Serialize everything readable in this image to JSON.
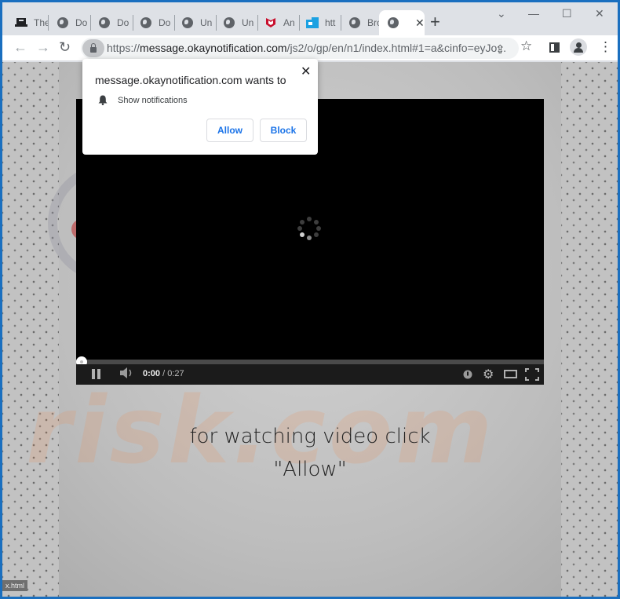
{
  "browser": {
    "tabs": [
      {
        "label": "The",
        "icon": "printer-icon"
      },
      {
        "label": "Do",
        "icon": "globe-icon"
      },
      {
        "label": "Do",
        "icon": "globe-icon"
      },
      {
        "label": "Do",
        "icon": "globe-icon"
      },
      {
        "label": "Un",
        "icon": "globe-icon"
      },
      {
        "label": "Un",
        "icon": "globe-icon"
      },
      {
        "label": "An",
        "icon": "mcafee-shield-icon"
      },
      {
        "label": "htt",
        "icon": "blue-square-icon"
      },
      {
        "label": "Bro",
        "icon": "globe-icon"
      }
    ],
    "active_tab": {
      "icon": "globe-icon",
      "close": "✕"
    },
    "new_tab": "+",
    "window_controls": {
      "dropdown": "⌄",
      "minimize": "—",
      "maximize": "☐",
      "close": "✕"
    },
    "nav": {
      "back": "←",
      "forward": "→",
      "reload": "↻"
    },
    "url": {
      "scheme": "https://",
      "host": "message.okaynotification.com",
      "path": "/js2/o/gp/en/n1/index.html#1=a&cinfo=eyJo..."
    },
    "toolbar_icons": {
      "share": "⇪",
      "bookmark": "☆",
      "menu": "⋮"
    }
  },
  "permission_popup": {
    "title": "message.okaynotification.com wants to",
    "permission": "Show notifications",
    "allow_label": "Allow",
    "block_label": "Block",
    "close": "✕"
  },
  "video": {
    "time_current": "0:00",
    "time_total": " / 0:27",
    "progress": 0
  },
  "page": {
    "message_line1": "for watching video click",
    "message_line2": "\"Allow\"",
    "watermark": "risk.com",
    "status_text": "x.html"
  }
}
